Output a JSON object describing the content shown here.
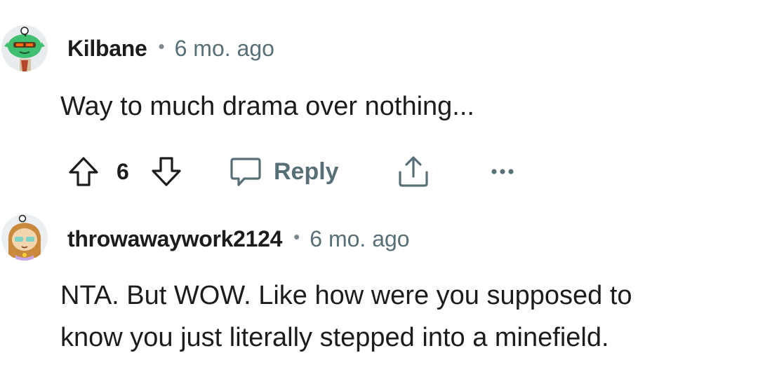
{
  "comments": [
    {
      "username": "Kilbane",
      "separator": "•",
      "age": "6 mo. ago",
      "body_lines": [
        "Way to much drama over nothing..."
      ],
      "score": "6",
      "reply_label": "Reply",
      "avatar_icon": "snoo-avatar-green-icon",
      "colors": {
        "avatar_skin": "#3fbf6f",
        "accent": "#ff6a1a"
      }
    },
    {
      "username": "throwawaywork2124",
      "separator": "•",
      "age": "6 mo. ago",
      "body_lines": [
        "NTA. But WOW. Like how were you supposed to",
        "know you just literally stepped into a minefield."
      ],
      "avatar_icon": "snoo-avatar-teal-hair-icon",
      "colors": {
        "avatar_skin": "#f3d6b0",
        "hair": "#c98a3d"
      }
    }
  ],
  "icons": {
    "upvote": "upvote-arrow-icon",
    "downvote": "downvote-arrow-icon",
    "reply": "speech-bubble-icon",
    "share": "share-upload-icon",
    "more": "more-dots-icon"
  },
  "colors": {
    "text": "#1c1c1c",
    "meta": "#576f76",
    "icon": "#1c1c1c",
    "muted_icon": "#576f76"
  }
}
